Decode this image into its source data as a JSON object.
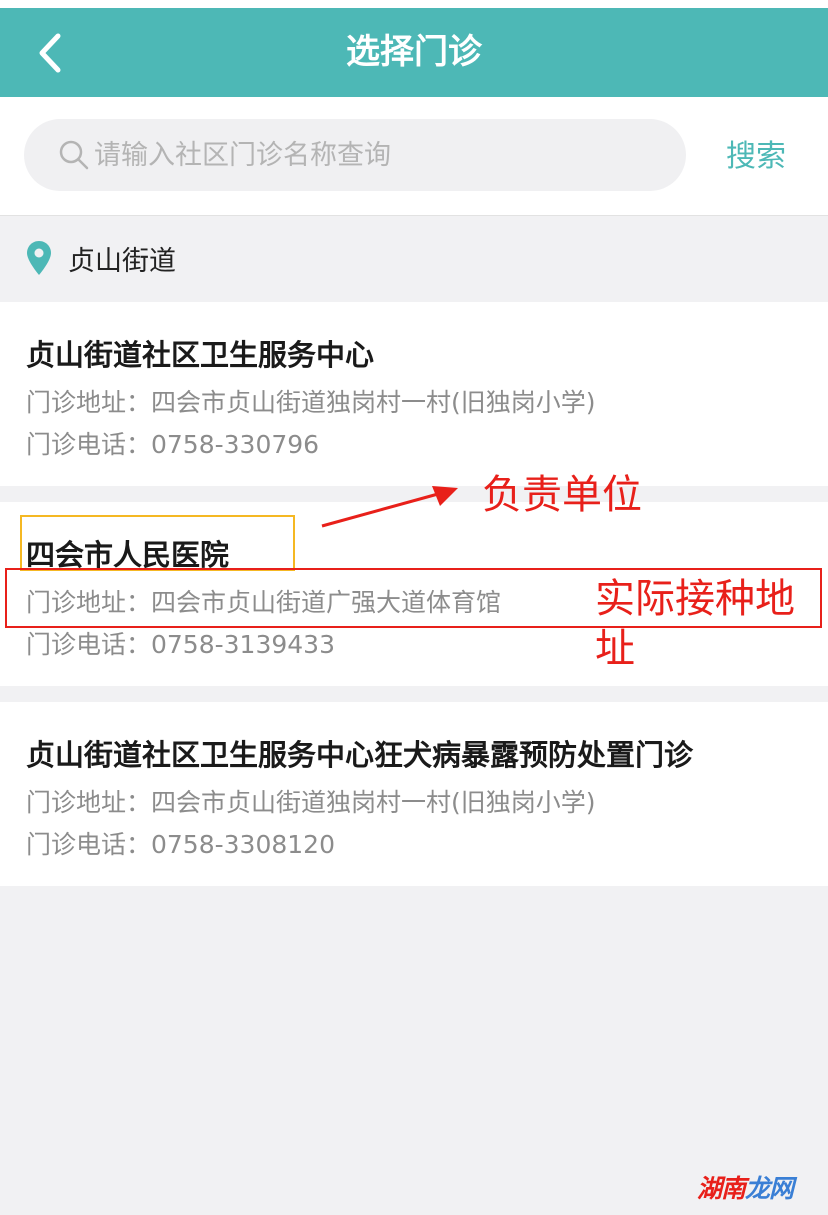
{
  "header": {
    "title": "选择门诊",
    "back_icon": "chevron-left-icon",
    "background": "#4db8b6"
  },
  "search": {
    "placeholder": "请输入社区门诊名称查询",
    "value": "",
    "button_label": "搜索",
    "icon": "search-icon"
  },
  "location": {
    "icon": "map-pin-icon",
    "label": "贞山街道"
  },
  "clinics": [
    {
      "name": "贞山街道社区卫生服务中心",
      "address": "门诊地址：四会市贞山街道独岗村一村(旧独岗小学)",
      "phone": "门诊电话：0758-330796"
    },
    {
      "name": "四会市人民医院",
      "address": "门诊地址：四会市贞山街道广强大道体育馆",
      "phone": "门诊电话：0758-3139433"
    },
    {
      "name": "贞山街道社区卫生服务中心狂犬病暴露预防处置门诊",
      "address": "门诊地址：四会市贞山街道独岗村一村(旧独岗小学)",
      "phone": "门诊电话：0758-3308120"
    }
  ],
  "annotations": {
    "responsible_unit": "负责单位",
    "actual_address": "实际接种地址",
    "color": "#e8201a",
    "highlight_color": "#f5b823"
  },
  "watermark": {
    "part1": "湖南",
    "part2": "龙网"
  }
}
